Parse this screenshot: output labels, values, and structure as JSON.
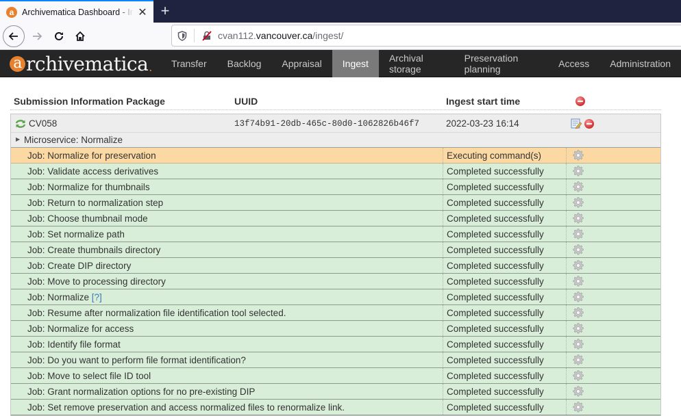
{
  "browser": {
    "tab_title": "Archivematica Dashboard - Ingest",
    "tab_favicon": "a",
    "new_tab_label": "+",
    "url_subdomain": "cvan112.",
    "url_domain": "vancouver.ca",
    "url_path": "/ingest/",
    "icons": {
      "back": "arrow-left-icon",
      "forward": "arrow-right-icon",
      "reload": "reload-icon",
      "home": "home-icon",
      "shield": "shield-icon",
      "insecure": "insecure-lock-icon"
    }
  },
  "app": {
    "logo_initial": "a",
    "logo_rest": "rchivematica",
    "logo_dot": ".",
    "brand_color": "#e8812d",
    "menu": [
      {
        "label": "Transfer",
        "active": false
      },
      {
        "label": "Backlog",
        "active": false
      },
      {
        "label": "Appraisal",
        "active": false
      },
      {
        "label": "Ingest",
        "active": true
      },
      {
        "label": "Archival storage",
        "active": false
      },
      {
        "label": "Preservation planning",
        "active": false
      },
      {
        "label": "Access",
        "active": false
      },
      {
        "label": "Administration",
        "active": false
      }
    ]
  },
  "table": {
    "headers": {
      "sip": "Submission Information Package",
      "uuid": "UUID",
      "start_time": "Ingest start time"
    },
    "sip": {
      "name": "CV058",
      "uuid": "13f74b91-20db-465c-80d0-1062826b46f7",
      "start_time": "2022-03-23 16:14"
    },
    "microservice": "Microservice: Normalize",
    "status_colors": {
      "executing": "#fcd9a3",
      "completed": "#d8eed9"
    },
    "jobs": [
      {
        "name": "Job: Normalize for preservation",
        "status": "Executing command(s)",
        "state": "executing"
      },
      {
        "name": "Job: Validate access derivatives",
        "status": "Completed successfully",
        "state": "completed"
      },
      {
        "name": "Job: Normalize for thumbnails",
        "status": "Completed successfully",
        "state": "completed"
      },
      {
        "name": "Job: Return to normalization step",
        "status": "Completed successfully",
        "state": "completed"
      },
      {
        "name": "Job: Choose thumbnail mode",
        "status": "Completed successfully",
        "state": "completed"
      },
      {
        "name": "Job: Set normalize path",
        "status": "Completed successfully",
        "state": "completed"
      },
      {
        "name": "Job: Create thumbnails directory",
        "status": "Completed successfully",
        "state": "completed"
      },
      {
        "name": "Job: Create DIP directory",
        "status": "Completed successfully",
        "state": "completed"
      },
      {
        "name": "Job: Move to processing directory",
        "status": "Completed successfully",
        "state": "completed"
      },
      {
        "name": "Job: Normalize",
        "help": "[?]",
        "status": "Completed successfully",
        "state": "completed"
      },
      {
        "name": "Job: Resume after normalization file identification tool selected.",
        "status": "Completed successfully",
        "state": "completed"
      },
      {
        "name": "Job: Normalize for access",
        "status": "Completed successfully",
        "state": "completed"
      },
      {
        "name": "Job: Identify file format",
        "status": "Completed successfully",
        "state": "completed"
      },
      {
        "name": "Job: Do you want to perform file format identification?",
        "status": "Completed successfully",
        "state": "completed"
      },
      {
        "name": "Job: Move to select file ID tool",
        "status": "Completed successfully",
        "state": "completed"
      },
      {
        "name": "Job: Grant normalization options for no pre-existing DIP",
        "status": "Completed successfully",
        "state": "completed"
      },
      {
        "name": "Job: Set remove preservation and access normalized files to renormalize link.",
        "status": "Completed successfully",
        "state": "completed"
      }
    ]
  }
}
